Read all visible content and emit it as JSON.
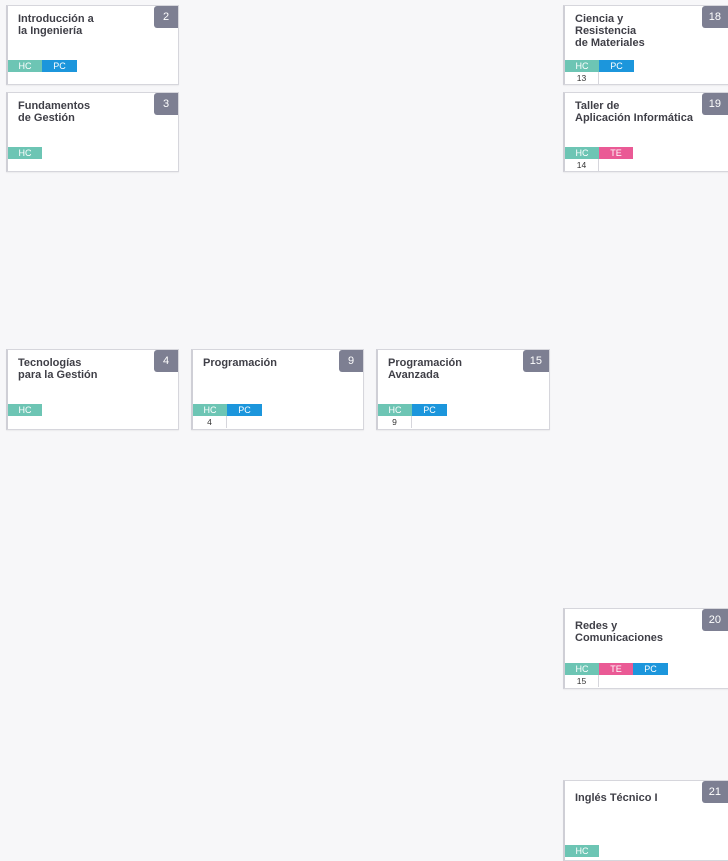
{
  "colors": {
    "hc": "#6dc5b4",
    "pc": "#1c96dc",
    "te": "#ea5a95",
    "number_badge": "#7d7f92"
  },
  "tag_labels": {
    "hc": "HC",
    "pc": "PC",
    "te": "TE"
  },
  "courses": [
    {
      "id": "c2",
      "title": "Introducción a\nla Ingeniería",
      "number": "2",
      "tags": [
        "HC",
        "PC"
      ],
      "prereq": ""
    },
    {
      "id": "c3",
      "title": "Fundamentos\nde Gestión",
      "number": "3",
      "tags": [
        "HC"
      ],
      "prereq": ""
    },
    {
      "id": "c4",
      "title": "Tecnologías\npara la Gestión",
      "number": "4",
      "tags": [
        "HC"
      ],
      "prereq": ""
    },
    {
      "id": "c9",
      "title": "Programación",
      "number": "9",
      "tags": [
        "HC",
        "PC"
      ],
      "prereq": "4"
    },
    {
      "id": "c15",
      "title": "Programación\nAvanzada",
      "number": "15",
      "tags": [
        "HC",
        "PC"
      ],
      "prereq": "9"
    },
    {
      "id": "c18",
      "title": "Ciencia y\nResistencia\nde Materiales",
      "number": "18",
      "tags": [
        "HC",
        "PC"
      ],
      "prereq": "13"
    },
    {
      "id": "c19",
      "title": "Taller de\nAplicación Informática",
      "number": "19",
      "tags": [
        "HC",
        "TE"
      ],
      "prereq": "14"
    },
    {
      "id": "c20",
      "title": "Redes y\nComunicaciones",
      "number": "20",
      "tags": [
        "HC",
        "TE",
        "PC"
      ],
      "prereq": "15"
    },
    {
      "id": "c21",
      "title": "Inglés Técnico I",
      "number": "21",
      "tags": [
        "HC"
      ],
      "prereq": ""
    }
  ]
}
